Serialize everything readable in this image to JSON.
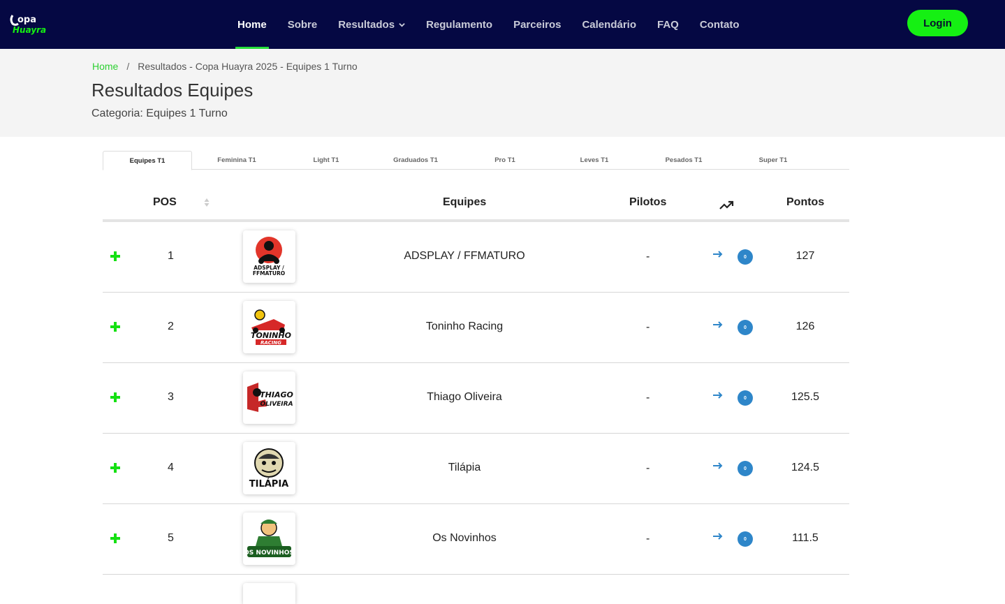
{
  "brand": {
    "logo_text": "Copa Huayra",
    "accent": "#15f013",
    "nav_bg": "#050843"
  },
  "nav": {
    "items": [
      {
        "label": "Home",
        "active": true
      },
      {
        "label": "Sobre"
      },
      {
        "label": "Resultados",
        "dropdown": true
      },
      {
        "label": "Regulamento"
      },
      {
        "label": "Parceiros"
      },
      {
        "label": "Calendário"
      },
      {
        "label": "FAQ"
      },
      {
        "label": "Contato"
      }
    ],
    "login_label": "Login"
  },
  "breadcrumb": {
    "home": "Home",
    "separator": "/",
    "current": "Resultados - Copa Huayra 2025 - Equipes 1 Turno"
  },
  "header": {
    "title": "Resultados Equipes",
    "subtitle": "Categoria: Equipes 1 Turno"
  },
  "tabs": [
    {
      "label": "Equipes T1",
      "active": true
    },
    {
      "label": "Feminina T1"
    },
    {
      "label": "Light T1"
    },
    {
      "label": "Graduados T1"
    },
    {
      "label": "Pro T1"
    },
    {
      "label": "Leves T1"
    },
    {
      "label": "Pesados T1"
    },
    {
      "label": "Super T1"
    }
  ],
  "table": {
    "columns": {
      "pos": "POS",
      "equipes": "Equipes",
      "pilotos": "Pilotos",
      "trend": "trend-icon",
      "pontos": "Pontos"
    },
    "rows": [
      {
        "pos": "1",
        "team": "ADSPLAY / FFMATURO",
        "logo_text": "ADSPLAY / FFMATURO",
        "pilotos": "-",
        "badge": "0",
        "pontos": "127"
      },
      {
        "pos": "2",
        "team": "Toninho Racing",
        "logo_text": "TONINHO RACING",
        "pilotos": "-",
        "badge": "0",
        "pontos": "126"
      },
      {
        "pos": "3",
        "team": "Thiago Oliveira",
        "logo_text": "THIAGO OLIVEIRA",
        "pilotos": "-",
        "badge": "0",
        "pontos": "125.5"
      },
      {
        "pos": "4",
        "team": "Tilápia",
        "logo_text": "TILÁPIA",
        "pilotos": "-",
        "badge": "0",
        "pontos": "124.5"
      },
      {
        "pos": "5",
        "team": "Os Novinhos",
        "logo_text": "OS NOVINHOS",
        "pilotos": "-",
        "badge": "0",
        "pontos": "111.5"
      }
    ]
  }
}
